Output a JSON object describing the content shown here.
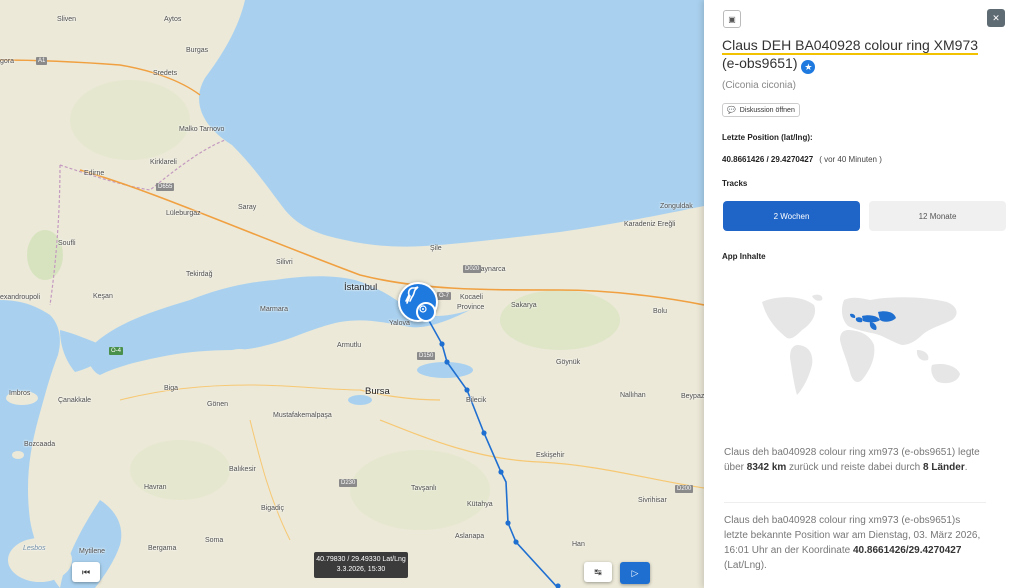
{
  "map": {
    "places": [
      {
        "name": "Sliven",
        "cls": ""
      },
      {
        "name": "Aytos",
        "cls": ""
      },
      {
        "name": "Burgas",
        "cls": ""
      },
      {
        "name": "Sredets",
        "cls": ""
      },
      {
        "name": "Malko Tarnovo",
        "cls": ""
      },
      {
        "name": "Kirklareli",
        "cls": ""
      },
      {
        "name": "Edirne",
        "cls": ""
      },
      {
        "name": "Lüleburgaz",
        "cls": ""
      },
      {
        "name": "Saray",
        "cls": ""
      },
      {
        "name": "Soufli",
        "cls": ""
      },
      {
        "name": "Tekirdağ",
        "cls": ""
      },
      {
        "name": "Silivri",
        "cls": ""
      },
      {
        "name": "Keşan",
        "cls": ""
      },
      {
        "name": "Marmara",
        "cls": ""
      },
      {
        "name": "İstanbul",
        "cls": "big"
      },
      {
        "name": "Şile",
        "cls": ""
      },
      {
        "name": "Kaynarca",
        "cls": ""
      },
      {
        "name": "Kocaeli",
        "cls": ""
      },
      {
        "name": "Province",
        "cls": ""
      },
      {
        "name": "Sakarya",
        "cls": ""
      },
      {
        "name": "Bolu",
        "cls": ""
      },
      {
        "name": "Zonguldak",
        "cls": ""
      },
      {
        "name": "Karadeniz Ereğli",
        "cls": ""
      },
      {
        "name": "Yalova",
        "cls": ""
      },
      {
        "name": "Armutlu",
        "cls": ""
      },
      {
        "name": "Bursa",
        "cls": "big"
      },
      {
        "name": "Bilecik",
        "cls": ""
      },
      {
        "name": "Göynük",
        "cls": ""
      },
      {
        "name": "Nallıhan",
        "cls": ""
      },
      {
        "name": "Beypazarı",
        "cls": ""
      },
      {
        "name": "Eskişehir",
        "cls": ""
      },
      {
        "name": "Çanakkale",
        "cls": ""
      },
      {
        "name": "Biga",
        "cls": ""
      },
      {
        "name": "Gönen",
        "cls": ""
      },
      {
        "name": "Mustafakemalpaşa",
        "cls": ""
      },
      {
        "name": "Balıkesir",
        "cls": ""
      },
      {
        "name": "Bozcaada",
        "cls": ""
      },
      {
        "name": "Havran",
        "cls": ""
      },
      {
        "name": "Tavşanlı",
        "cls": ""
      },
      {
        "name": "Kütahya",
        "cls": ""
      },
      {
        "name": "Bigadiç",
        "cls": ""
      },
      {
        "name": "Soma",
        "cls": ""
      },
      {
        "name": "Simav",
        "cls": ""
      },
      {
        "name": "Aslanapa",
        "cls": ""
      },
      {
        "name": "Sivrihisar",
        "cls": ""
      },
      {
        "name": "Han",
        "cls": ""
      },
      {
        "name": "Mytilene",
        "cls": ""
      },
      {
        "name": "Bergama",
        "cls": ""
      },
      {
        "name": "Lesbos",
        "cls": "sea"
      },
      {
        "name": "Imbros",
        "cls": ""
      },
      {
        "name": "exandroupoli",
        "cls": ""
      },
      {
        "name": "gora",
        "cls": ""
      }
    ],
    "roads": [
      "A1",
      "D655",
      "D020",
      "O-7",
      "O-4",
      "D150",
      "D230",
      "D200"
    ],
    "coord_line1": "40.79830 / 29.49330 Lat/Lng",
    "coord_line2": "3.3.2026, 15:30",
    "btn_first": "⏮",
    "btn_speed": "↹",
    "btn_play": "▷"
  },
  "panel": {
    "title_part1": "Claus DEH BA040928 colour ring XM973",
    "title_part2": " (e-obs9651)",
    "species": "(Ciconia ciconia)",
    "discussion": "Diskussion öffnen",
    "pos_heading": "Letzte Position (lat/lng):",
    "pos_value": "40.8661426 / 29.4270427",
    "pos_ago": "( vor 40 Minuten )",
    "tracks_heading": "Tracks",
    "tab_active": "2 Wochen",
    "tab_other": "12 Monate",
    "app_heading": "App Inhalte",
    "summary_a": "Claus deh ba040928 colour ring xm973 (e-obs9651) legte über ",
    "summary_km": "8342 km",
    "summary_b": " zurück und reiste dabei durch ",
    "summary_countries": "8 Länder",
    "summary_c": ".",
    "last_a": "Claus deh ba040928 colour ring xm973 (e-obs9651)s letzte bekannte Position war am Dienstag, 03. März 2026, 16:01 Uhr an der Koordinate ",
    "last_coord": "40.8661426/29.4270427",
    "last_b": " (Lat/Lng)."
  },
  "colors": {
    "accent": "#1f65c8",
    "track": "#1f6fd1",
    "highlight": "#f2c200"
  }
}
